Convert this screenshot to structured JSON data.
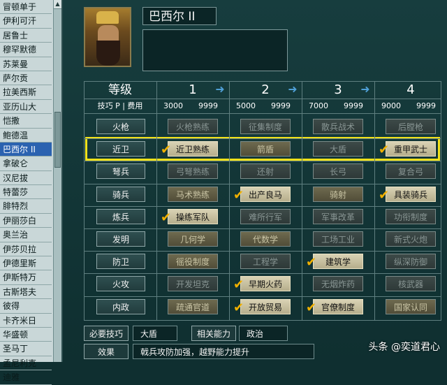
{
  "sidebar": {
    "items": [
      "冒顿单于",
      "伊利可汗",
      "居鲁士",
      "穆罕默德",
      "苏莱曼",
      "萨尔贡",
      "拉美西斯",
      "亚历山大",
      "恺撒",
      "鲍德温",
      "巴西尔 II",
      "拿破仑",
      "汉尼拔",
      "特蕾莎",
      "腓特烈",
      "伊丽莎白",
      "奥兰治",
      "伊莎贝拉",
      "伊德里斯",
      "伊斯特万",
      "古斯塔夫",
      "彼得",
      "卡齐米日",
      "华盛顿",
      "圣马丁",
      "孟尼利克",
      "迪雅"
    ],
    "selected_index": 10
  },
  "leader": {
    "name": "巴西尔 II",
    "portrait_icon": "leader-portrait"
  },
  "header": {
    "level_label": "等级",
    "skill_label": "技巧 P",
    "cost_label": "费用",
    "levels": [
      {
        "num": "1",
        "points": "3000",
        "cost": "9999"
      },
      {
        "num": "2",
        "points": "5000",
        "cost": "9999"
      },
      {
        "num": "3",
        "points": "7000",
        "cost": "9999"
      },
      {
        "num": "4",
        "points": "9000",
        "cost": "9999"
      }
    ]
  },
  "categories": [
    {
      "label": "火枪",
      "skills": [
        {
          "label": "火枪熟练",
          "state": "dim"
        },
        {
          "label": "征集制度",
          "state": "dim"
        },
        {
          "label": "散兵战术",
          "state": "dim"
        },
        {
          "label": "后膛枪",
          "state": "dim"
        }
      ]
    },
    {
      "label": "近卫",
      "skills": [
        {
          "label": "近卫熟练",
          "state": "learned"
        },
        {
          "label": "箭盾",
          "state": "lit"
        },
        {
          "label": "大盾",
          "state": "dim"
        },
        {
          "label": "重甲武士",
          "state": "learned"
        }
      ]
    },
    {
      "label": "弩兵",
      "skills": [
        {
          "label": "弓弩熟练",
          "state": "dim"
        },
        {
          "label": "还射",
          "state": "dim"
        },
        {
          "label": "长弓",
          "state": "dim"
        },
        {
          "label": "复合弓",
          "state": "dim"
        }
      ]
    },
    {
      "label": "骑兵",
      "skills": [
        {
          "label": "马术熟练",
          "state": "lit"
        },
        {
          "label": "出产良马",
          "state": "learned"
        },
        {
          "label": "骑射",
          "state": "lit"
        },
        {
          "label": "具装骑兵",
          "state": "learned"
        }
      ]
    },
    {
      "label": "炼兵",
      "skills": [
        {
          "label": "操练军队",
          "state": "learned"
        },
        {
          "label": "难所行军",
          "state": "dim"
        },
        {
          "label": "军事改革",
          "state": "dim"
        },
        {
          "label": "功衔制度",
          "state": "dim"
        }
      ]
    },
    {
      "label": "发明",
      "skills": [
        {
          "label": "几何学",
          "state": "lit"
        },
        {
          "label": "代数学",
          "state": "lit"
        },
        {
          "label": "工场工业",
          "state": "dim"
        },
        {
          "label": "新式火炮",
          "state": "dim"
        }
      ]
    },
    {
      "label": "防卫",
      "skills": [
        {
          "label": "徭役制度",
          "state": "lit"
        },
        {
          "label": "工程学",
          "state": "dim"
        },
        {
          "label": "建筑学",
          "state": "learned"
        },
        {
          "label": "纵深防御",
          "state": "dim"
        }
      ]
    },
    {
      "label": "火攻",
      "skills": [
        {
          "label": "开发坦克",
          "state": "dim"
        },
        {
          "label": "早期火药",
          "state": "learned"
        },
        {
          "label": "无烟炸药",
          "state": "dim"
        },
        {
          "label": "核武器",
          "state": "dim"
        }
      ]
    },
    {
      "label": "内政",
      "skills": [
        {
          "label": "疏通官道",
          "state": "lit"
        },
        {
          "label": "开放贸易",
          "state": "learned"
        },
        {
          "label": "官僚制度",
          "state": "learned"
        },
        {
          "label": "国家认同",
          "state": "lit"
        }
      ]
    }
  ],
  "footer": {
    "required_label": "必要技巧",
    "required_value": "大盾",
    "related_label": "相关能力",
    "related_value": "政治",
    "effect_label": "效果",
    "effect_value": "戟兵攻防加强，越野能力提升"
  },
  "watermark": "头条 @奕道君心",
  "colors": {
    "highlight": "#f2e21a",
    "check": "#f0b000",
    "selected": "#2b62b0"
  }
}
